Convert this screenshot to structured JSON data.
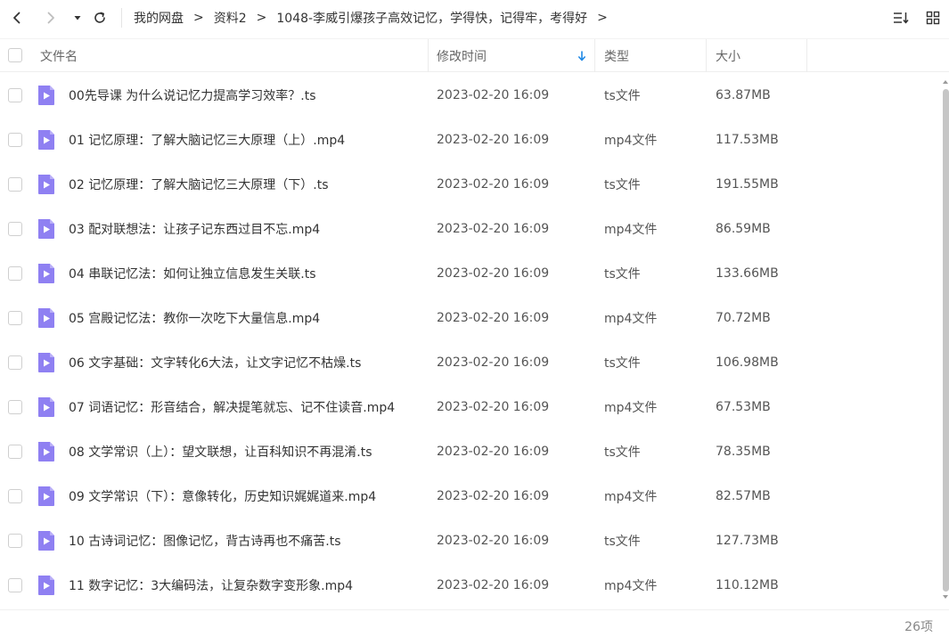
{
  "toolbar": {
    "back_icon": "chevron-left-icon",
    "forward_icon": "chevron-right-icon",
    "history_icon": "caret-down-icon",
    "refresh_icon": "refresh-icon",
    "sort_icon": "sort-list-icon",
    "grid_icon": "grid-view-icon"
  },
  "breadcrumb": {
    "items": [
      "我的网盘",
      "资料2",
      "1048-李威引爆孩子高效记忆，学得快，记得牢，考得好"
    ],
    "separator": ">"
  },
  "columns": {
    "name": "文件名",
    "modified": "修改时间",
    "type": "类型",
    "size": "大小"
  },
  "sort_indicator_color": "#1e88e5",
  "file_icon_color": "#8f80f2",
  "files": [
    {
      "name": "00先导课 为什么说记忆力提高学习效率？.ts",
      "modified": "2023-02-20 16:09",
      "type": "ts文件",
      "size": "63.87MB"
    },
    {
      "name": "01 记忆原理：了解大脑记忆三大原理（上）.mp4",
      "modified": "2023-02-20 16:09",
      "type": "mp4文件",
      "size": "117.53MB"
    },
    {
      "name": "02 记忆原理：了解大脑记忆三大原理（下）.ts",
      "modified": "2023-02-20 16:09",
      "type": "ts文件",
      "size": "191.55MB"
    },
    {
      "name": "03 配对联想法：让孩子记东西过目不忘.mp4",
      "modified": "2023-02-20 16:09",
      "type": "mp4文件",
      "size": "86.59MB"
    },
    {
      "name": "04 串联记忆法：如何让独立信息发生关联.ts",
      "modified": "2023-02-20 16:09",
      "type": "ts文件",
      "size": "133.66MB"
    },
    {
      "name": "05 宫殿记忆法：教你一次吃下大量信息.mp4",
      "modified": "2023-02-20 16:09",
      "type": "mp4文件",
      "size": "70.72MB"
    },
    {
      "name": "06 文字基础：文字转化6大法，让文字记忆不枯燥.ts",
      "modified": "2023-02-20 16:09",
      "type": "ts文件",
      "size": "106.98MB"
    },
    {
      "name": "07 词语记忆：形音结合，解决提笔就忘、记不住读音.mp4",
      "modified": "2023-02-20 16:09",
      "type": "mp4文件",
      "size": "67.53MB"
    },
    {
      "name": "08 文学常识（上）：望文联想，让百科知识不再混淆.ts",
      "modified": "2023-02-20 16:09",
      "type": "ts文件",
      "size": "78.35MB"
    },
    {
      "name": "09 文学常识（下）：意像转化，历史知识娓娓道来.mp4",
      "modified": "2023-02-20 16:09",
      "type": "mp4文件",
      "size": "82.57MB"
    },
    {
      "name": "10 古诗词记忆：图像记忆，背古诗再也不痛苦.ts",
      "modified": "2023-02-20 16:09",
      "type": "ts文件",
      "size": "127.73MB"
    },
    {
      "name": "11 数字记忆：3大编码法，让复杂数字变形象.mp4",
      "modified": "2023-02-20 16:09",
      "type": "mp4文件",
      "size": "110.12MB"
    }
  ],
  "footer": {
    "count": "26项"
  }
}
